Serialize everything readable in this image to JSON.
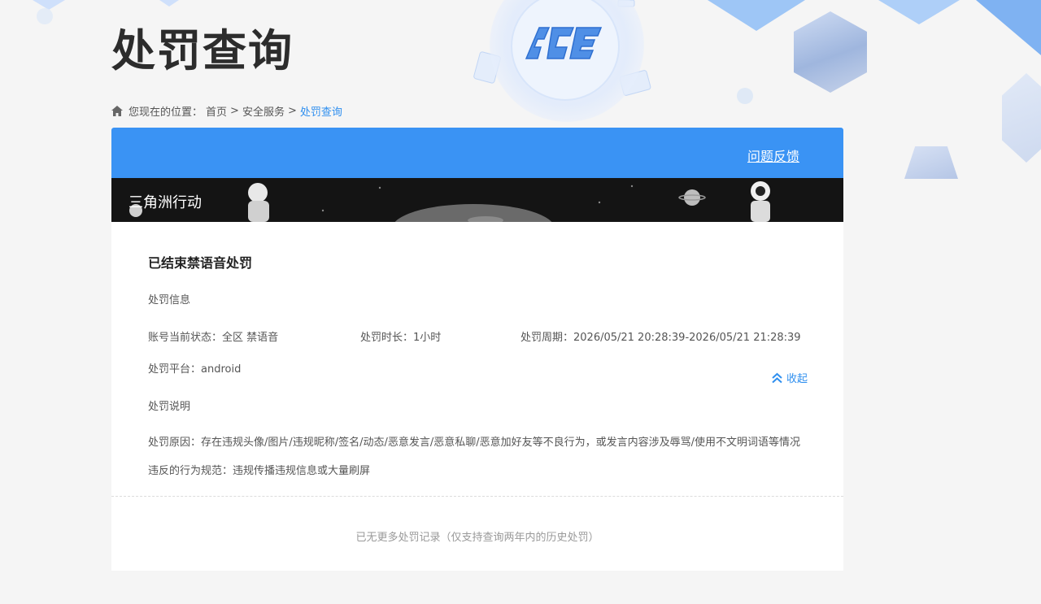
{
  "page": {
    "title": "处罚查询"
  },
  "breadcrumb": {
    "prefix": "您现在的位置：",
    "items": [
      "首页",
      "安全服务",
      "处罚查询"
    ],
    "separator": ">"
  },
  "header": {
    "feedback_label": "问题反馈"
  },
  "banner": {
    "game_name": "三角洲行动"
  },
  "record": {
    "title": "已结束禁语音处罚",
    "info_section_label": "处罚信息",
    "status": "账号当前状态：全区 禁语音",
    "duration": "处罚时长：1小时",
    "period": "处罚周期：2026/05/21 20:28:39-2026/05/21 21:28:39",
    "platform": "处罚平台：android",
    "desc_section_label": "处罚说明",
    "reason": "处罚原因：存在违规头像/图片/违规昵称/签名/动态/恶意发言/恶意私聊/恶意加好友等不良行为，或发言内容涉及辱骂/使用不文明词语等情况",
    "rule": "违反的行为规范：违规传播违规信息或大量刷屏",
    "collapse_label": "收起"
  },
  "footer": {
    "no_more_text": "已无更多处罚记录（仅支持查询两年内的历史处罚）"
  },
  "colors": {
    "accent": "#3a93f4",
    "link": "#2f8fef",
    "banner_bg": "#141414"
  },
  "icons": [
    "home-icon",
    "double-chevron-up-icon",
    "ace-logo"
  ]
}
